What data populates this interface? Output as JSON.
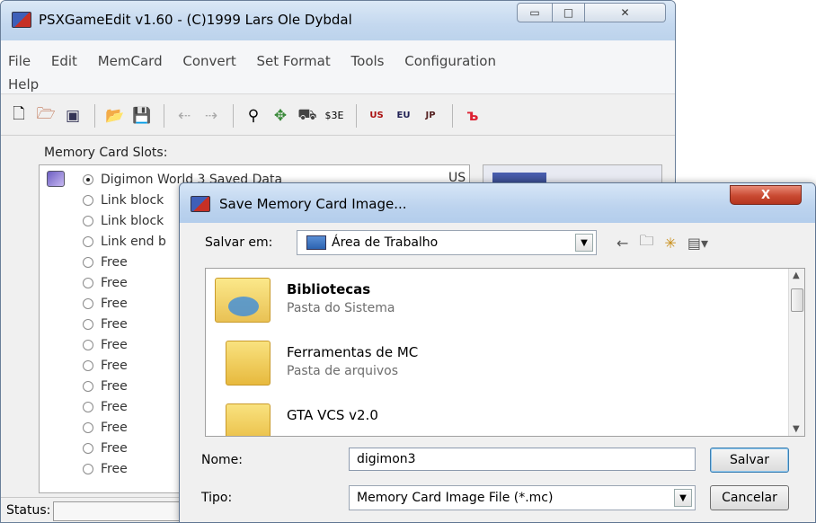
{
  "main_window": {
    "title": "PSXGameEdit v1.60 - (C)1999 Lars Ole Dybdal",
    "caption": {
      "minimize": "▭",
      "maximize": "□",
      "close": "✕"
    },
    "menu": [
      "File",
      "Edit",
      "MemCard",
      "Convert",
      "Set Format",
      "Tools",
      "Configuration",
      "Help"
    ],
    "toolbar": {
      "new": "🗋",
      "open_game": "🗁",
      "memcard": "▣",
      "open": "📂",
      "save": "💾",
      "copy_left": "⇠",
      "copy_right": "⇢",
      "tool1": "⚲",
      "tool2": "✥",
      "tool3": "⛟",
      "tool_3e": "$3E",
      "format_us": "US",
      "format_eu": "EU",
      "format_jp": "JP",
      "misc": "ъ"
    },
    "slots_label": "Memory Card Slots:",
    "slots": [
      {
        "label": "Digimon World 3 Saved Data",
        "region": "US",
        "selected": true
      },
      {
        "label": "Link block"
      },
      {
        "label": "Link block"
      },
      {
        "label": "Link end b"
      },
      {
        "label": "Free"
      },
      {
        "label": "Free"
      },
      {
        "label": "Free"
      },
      {
        "label": "Free"
      },
      {
        "label": "Free"
      },
      {
        "label": "Free"
      },
      {
        "label": "Free"
      },
      {
        "label": "Free"
      },
      {
        "label": "Free"
      },
      {
        "label": "Free"
      },
      {
        "label": "Free"
      }
    ],
    "status_label": "Status:"
  },
  "dialog": {
    "title": "Save Memory Card Image...",
    "close": "X",
    "save_in_label": "Salvar em:",
    "save_in_value": "Área de Trabalho",
    "combo_arrow": "▼",
    "nav": {
      "back": "←",
      "up": "🗀",
      "new_folder": "✳",
      "view": "▤▾"
    },
    "files": [
      {
        "name": "Bibliotecas",
        "type": "Pasta do Sistema"
      },
      {
        "name": "Ferramentas de MC",
        "type": "Pasta de arquivos"
      },
      {
        "name": "GTA VCS v2.0",
        "type": ""
      }
    ],
    "scroll_up": "▲",
    "scroll_down": "▼",
    "name_label": "Nome:",
    "name_value": "digimon3",
    "type_label": "Tipo:",
    "type_value": "Memory Card Image File (*.mc)",
    "save_button": "Salvar",
    "cancel_button": "Cancelar"
  }
}
